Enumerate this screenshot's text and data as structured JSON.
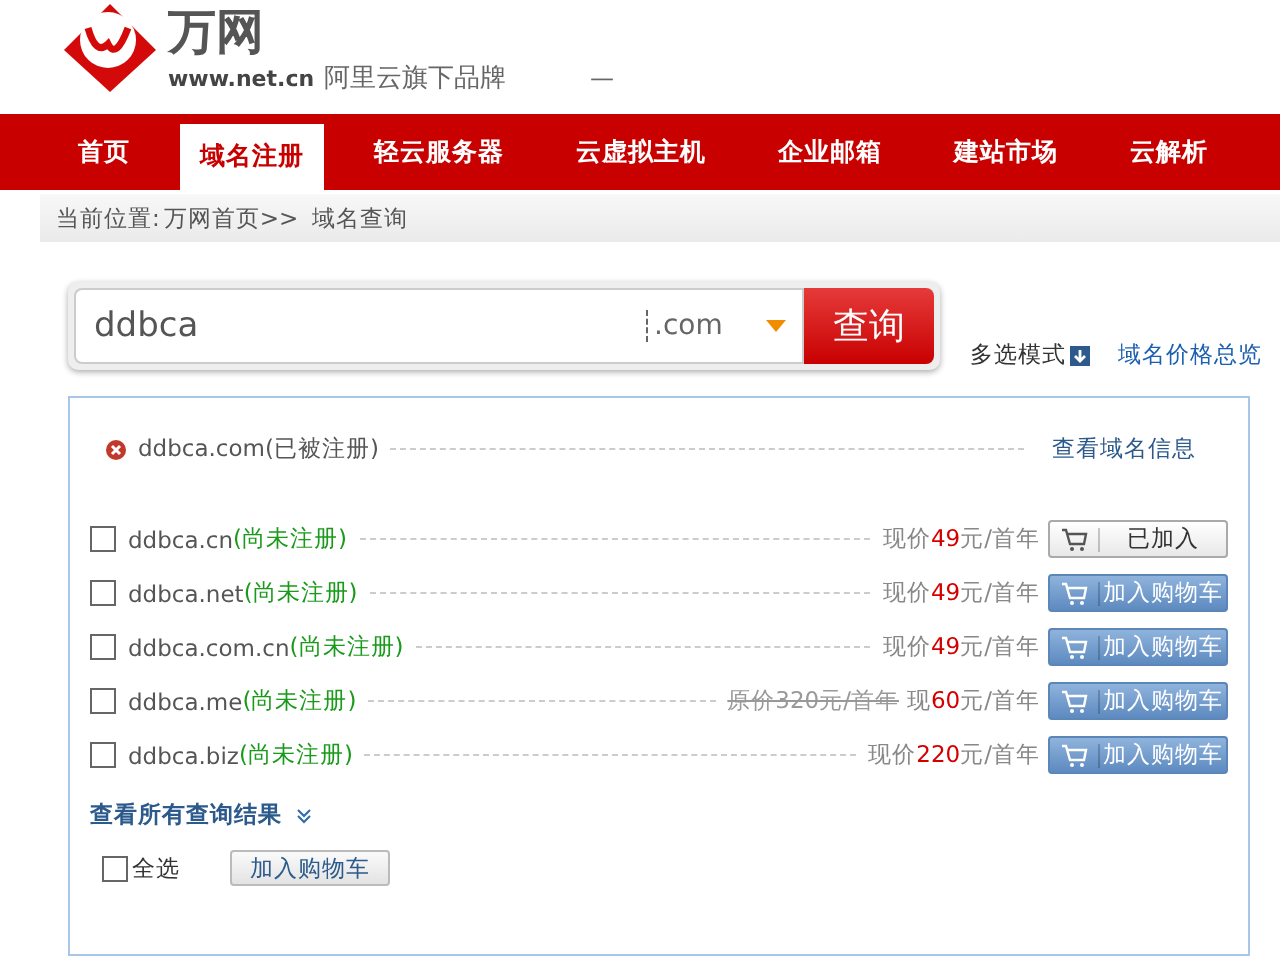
{
  "header": {
    "logo_text": "万网",
    "logo_url": "www.net.cn",
    "slogan": "阿里云旗下品牌",
    "top_mark": "—"
  },
  "nav": [
    {
      "label": "首页",
      "selected": false
    },
    {
      "label": "域名注册",
      "selected": true
    },
    {
      "label": "轻云服务器",
      "selected": false
    },
    {
      "label": "云虚拟主机",
      "selected": false
    },
    {
      "label": "企业邮箱",
      "selected": false
    },
    {
      "label": "建站市场",
      "selected": false
    },
    {
      "label": "云解析",
      "selected": false
    }
  ],
  "breadcrumb": {
    "prefix": "当前位置:",
    "home": "万网首页>>",
    "current": "域名查询"
  },
  "search": {
    "value": "ddbca",
    "suffix": ".com",
    "button": "查询",
    "multi_mode": "多选模式",
    "price_overview": "域名价格总览"
  },
  "registered": {
    "domain": "ddbca.com",
    "status": "(已被注册)",
    "link": "查看域名信息"
  },
  "results": [
    {
      "domain": "ddbca.cn",
      "status": "(尚未注册)",
      "checked": false,
      "price_label": "现价",
      "price": "49",
      "unit": "元/首年",
      "added": true,
      "button": "已加入"
    },
    {
      "domain": "ddbca.net",
      "status": "(尚未注册)",
      "checked": false,
      "price_label": "现价",
      "price": "49",
      "unit": "元/首年",
      "added": false,
      "button": "加入购物车"
    },
    {
      "domain": "ddbca.com.cn",
      "status": "(尚未注册)",
      "checked": false,
      "price_label": "现价",
      "price": "49",
      "unit": "元/首年",
      "added": false,
      "button": "加入购物车"
    },
    {
      "domain": "ddbca.me",
      "status": "(尚未注册)",
      "checked": false,
      "original_price": "原价320元/首年",
      "price_label": "现",
      "price": "60",
      "unit": "元/首年",
      "added": false,
      "button": "加入购物车"
    },
    {
      "domain": "ddbca.biz",
      "status": "(尚未注册)",
      "checked": false,
      "price_label": "现价",
      "price": "220",
      "unit": "元/首年",
      "added": false,
      "button": "加入购物车"
    }
  ],
  "view_all": "查看所有查询结果",
  "select_all": {
    "label": "全选",
    "checked": false
  },
  "bulk_button": "加入购物车"
}
